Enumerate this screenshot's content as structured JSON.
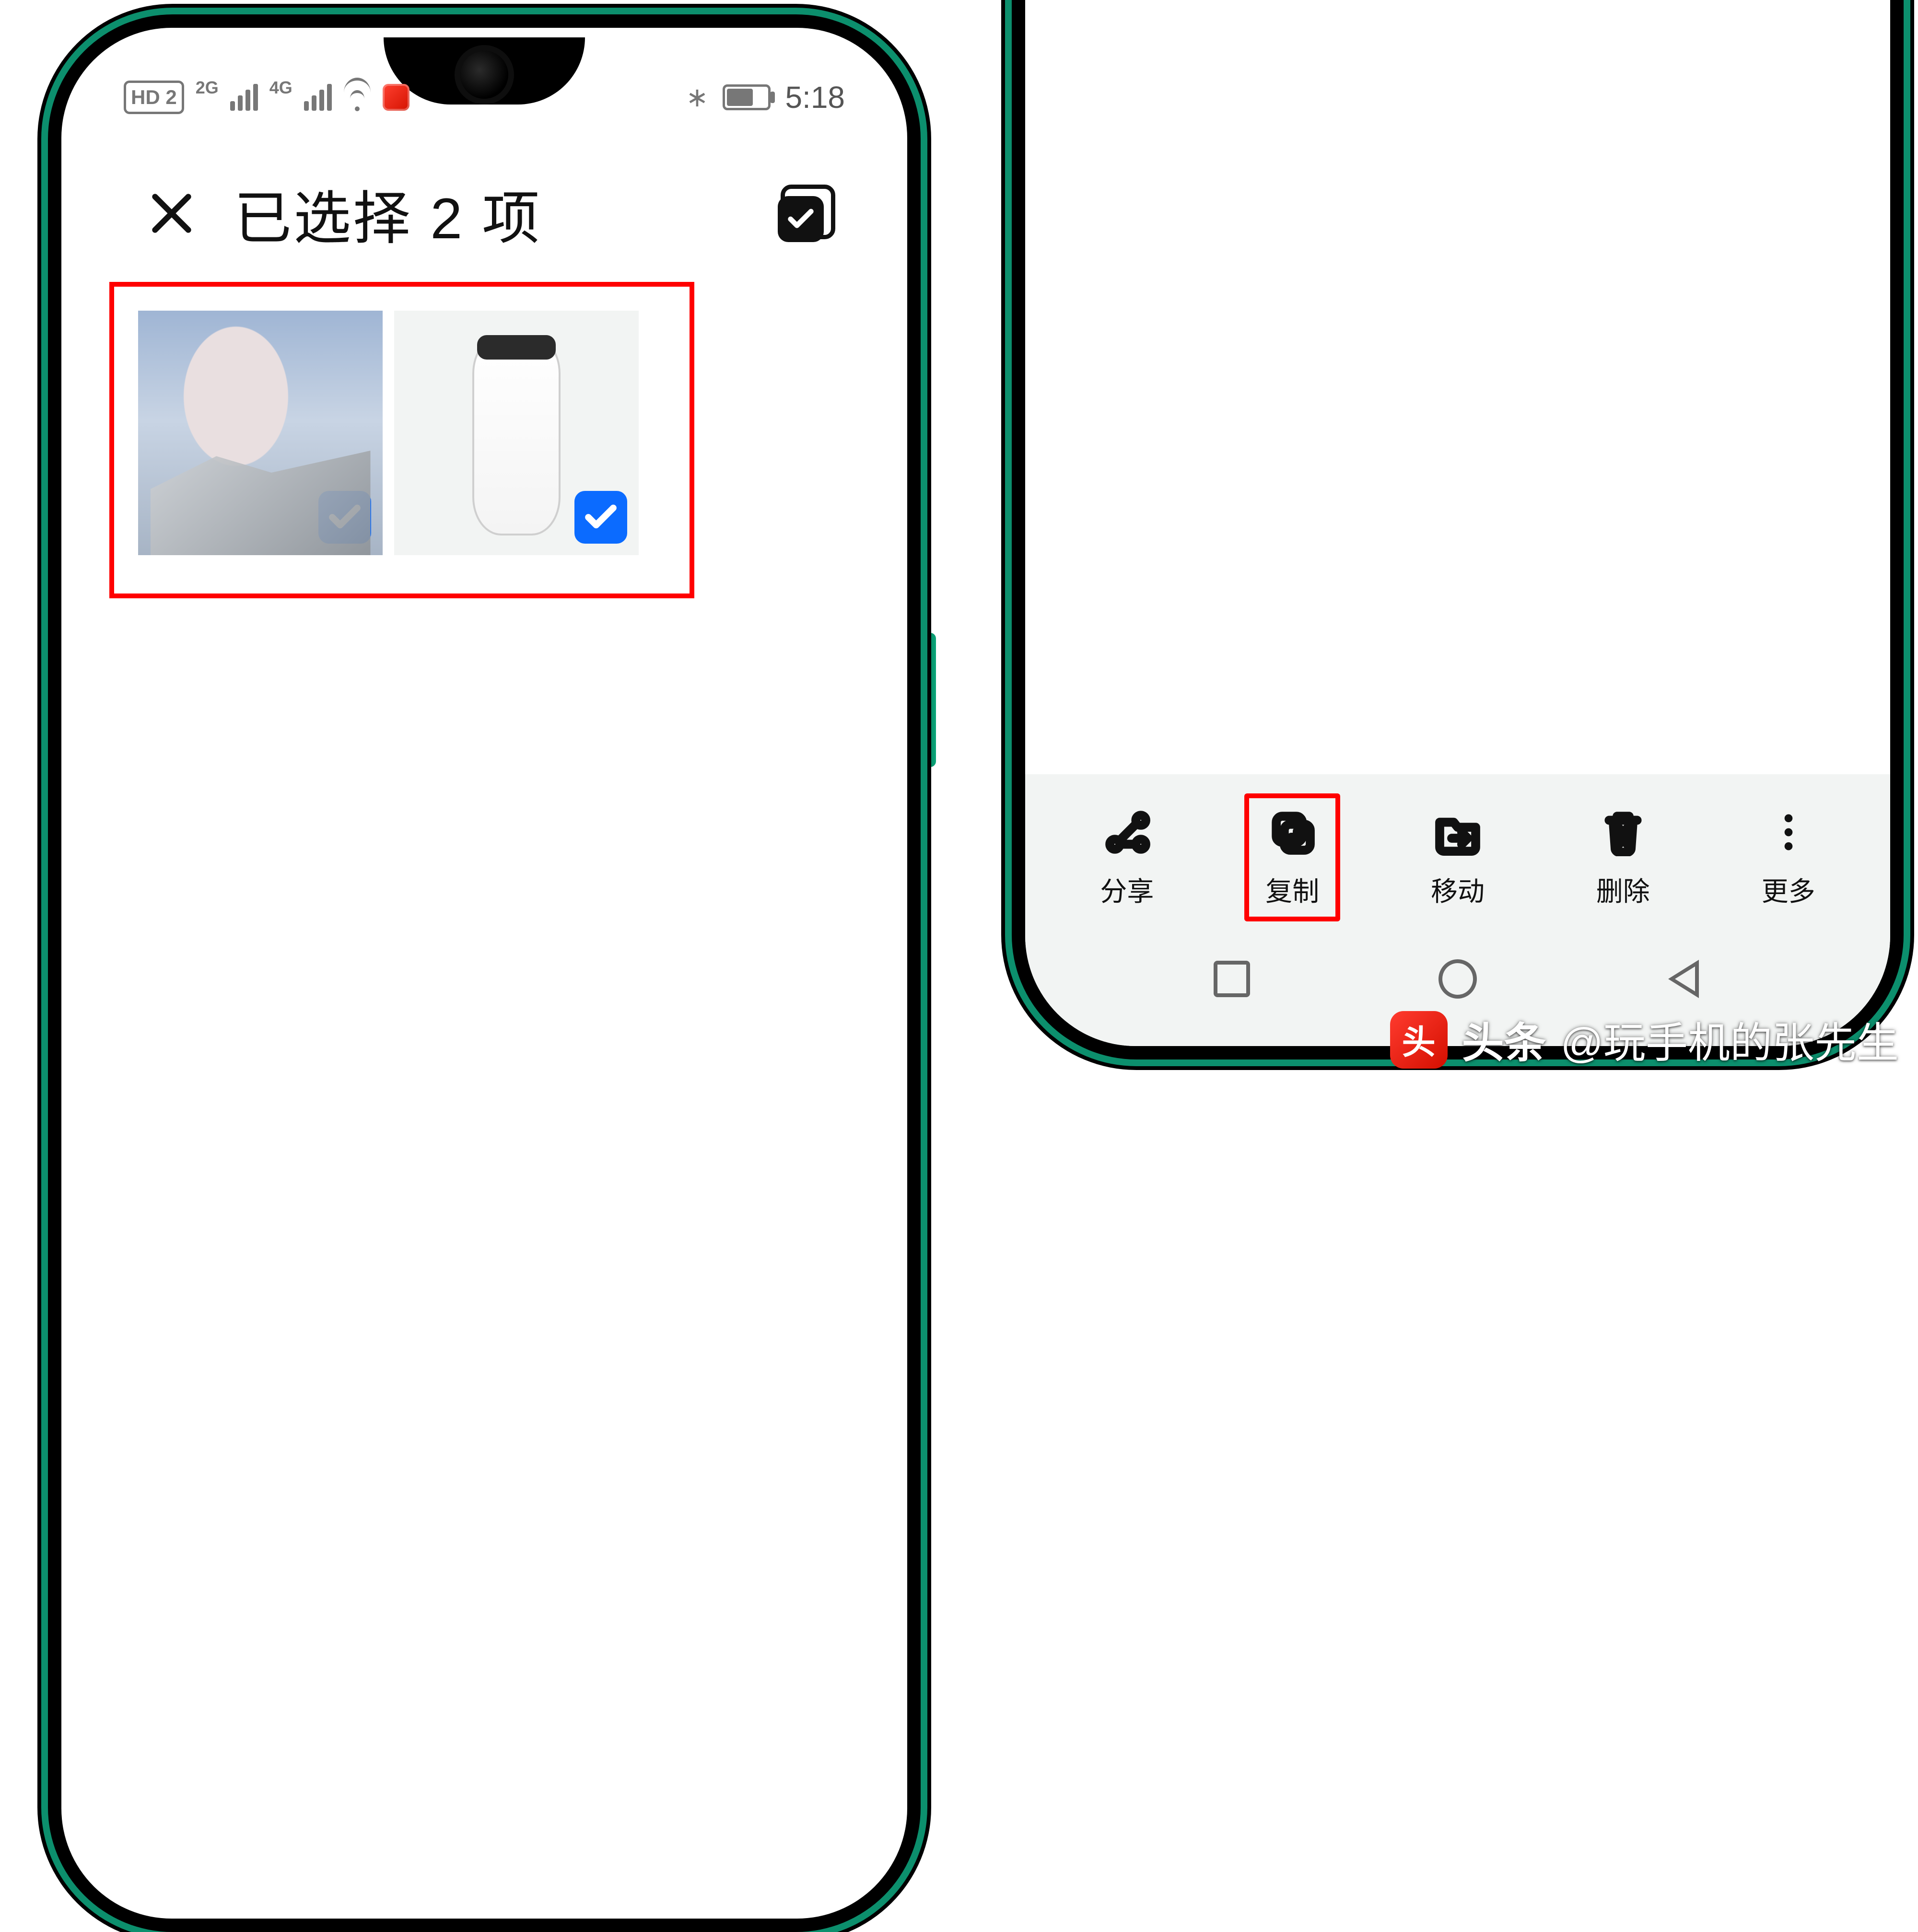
{
  "status_bar": {
    "hd_badge": "HD 2",
    "net1_tag": "2G",
    "net2_tag": "4G",
    "time": "5:18"
  },
  "header": {
    "title": "已选择 2 项"
  },
  "thumbnails": {
    "items": [
      {
        "name": "person-photo",
        "checked": true
      },
      {
        "name": "bottle-photo",
        "checked": true
      }
    ]
  },
  "action_bar": {
    "share": "分享",
    "copy": "复制",
    "move": "移动",
    "delete": "删除",
    "more": "更多"
  },
  "watermark": {
    "brand": "头条",
    "handle": "@玩手机的张先生"
  }
}
